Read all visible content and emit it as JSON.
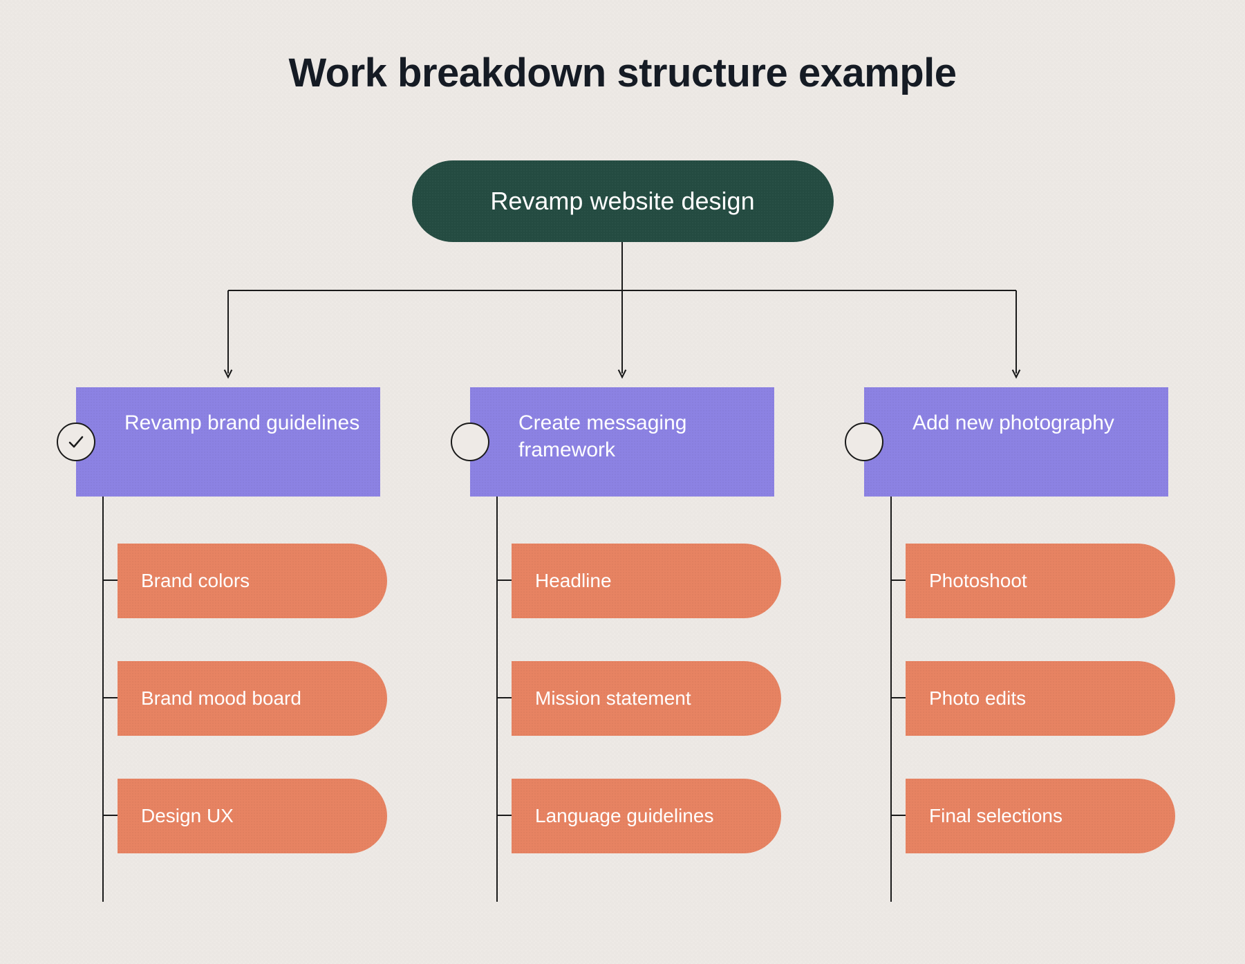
{
  "title": "Work breakdown structure example",
  "root": {
    "label": "Revamp website design"
  },
  "branches": [
    {
      "label": "Revamp brand guidelines",
      "checked": true,
      "leaves": [
        "Brand colors",
        "Brand mood board",
        "Design UX"
      ]
    },
    {
      "label": "Create messaging framework",
      "checked": false,
      "leaves": [
        "Headline",
        "Mission statement",
        "Language guidelines"
      ]
    },
    {
      "label": "Add new photography",
      "checked": false,
      "leaves": [
        "Photoshoot",
        "Photo edits",
        "Final selections"
      ]
    }
  ],
  "colors": {
    "background": "#eeeae6",
    "root_bg": "#244b41",
    "branch_bg": "#8c82e3",
    "leaf_bg": "#e78362",
    "line": "#1a1a1a"
  }
}
